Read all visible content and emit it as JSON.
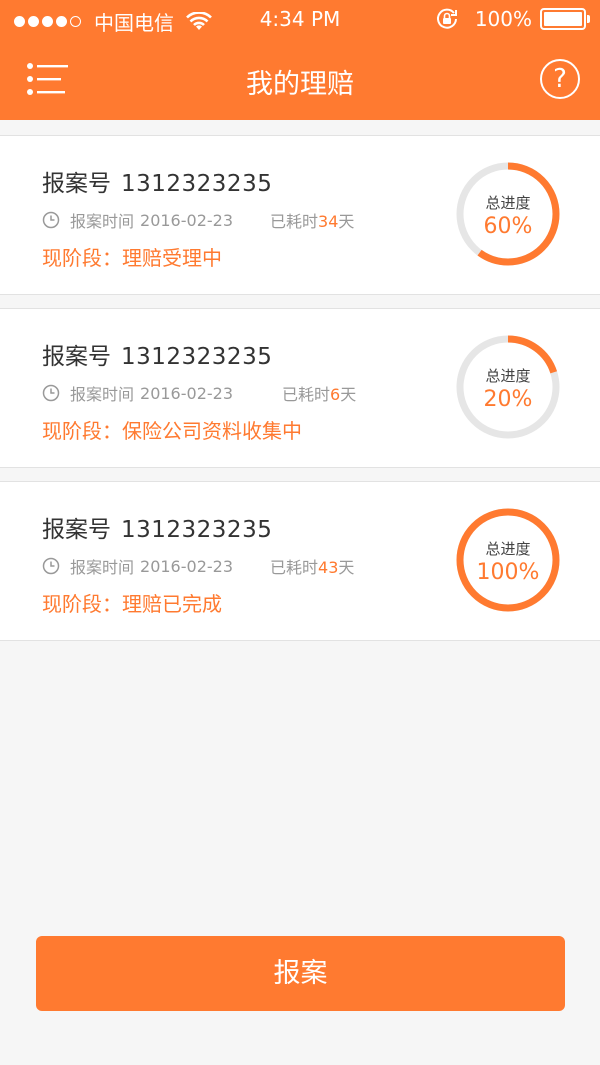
{
  "status_bar": {
    "carrier": "中国电信",
    "time": "4:34 PM",
    "battery": "100%"
  },
  "nav": {
    "title": "我的理赔",
    "help_label": "?"
  },
  "claims": [
    {
      "label": "报案号",
      "number": "1312323235",
      "time_label": "报案时间",
      "date": "2016-02-23",
      "elapsed_prefix": "已耗时",
      "elapsed_days": "34",
      "elapsed_suffix": "天",
      "stage": "现阶段：理赔受理中",
      "progress_label": "总进度",
      "progress_text": "60%",
      "progress": 0.6
    },
    {
      "label": "报案号",
      "number": "1312323235",
      "time_label": "报案时间",
      "date": "2016-02-23",
      "elapsed_prefix": "已耗时",
      "elapsed_days": "6",
      "elapsed_suffix": "天",
      "stage": "现阶段：保险公司资料收集中",
      "progress_label": "总进度",
      "progress_text": "20%",
      "progress": 0.2
    },
    {
      "label": "报案号",
      "number": "1312323235",
      "time_label": "报案时间",
      "date": "2016-02-23",
      "elapsed_prefix": "已耗时",
      "elapsed_days": "43",
      "elapsed_suffix": "天",
      "stage": "现阶段：理赔已完成",
      "progress_label": "总进度",
      "progress_text": "100%",
      "progress": 1.0
    }
  ],
  "report_button": "报案",
  "colors": {
    "accent": "#ff7a30",
    "ring_track": "#e6e6e6",
    "background": "#f6f6f6"
  },
  "icons": {
    "menu": "menu-list-icon",
    "help": "help-circle-icon",
    "clock": "clock-icon",
    "wifi": "wifi-icon",
    "lock": "rotation-lock-icon"
  }
}
